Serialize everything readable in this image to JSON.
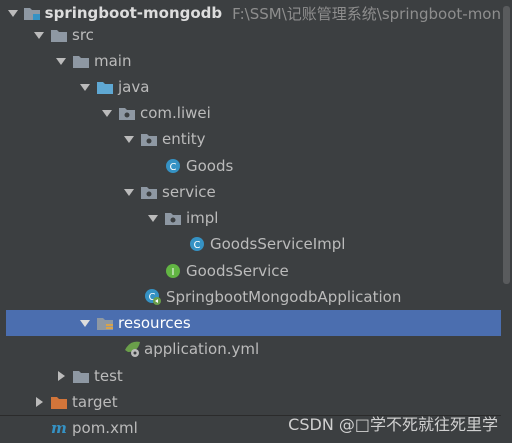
{
  "project": {
    "name": "springboot-mongodb",
    "path": "F:\\SSM\\记账管理系统\\springboot-mon"
  },
  "tree": {
    "src": "src",
    "main": "main",
    "java": "java",
    "package": "com.liwei",
    "entity": "entity",
    "goods": "Goods",
    "service": "service",
    "impl": "impl",
    "goods_service_impl": "GoodsServiceImpl",
    "goods_service": "GoodsService",
    "application_class": "SpringbootMongodbApplication",
    "resources": "resources",
    "application_yml": "application.yml",
    "test": "test",
    "target": "target",
    "pom": "pom.xml"
  },
  "watermark": "CSDN @□学不死就往死里学",
  "colors": {
    "background": "#3c3f41",
    "selection": "#4b6eaf",
    "folder": "#8e98a3",
    "source_folder": "#5fa8d3",
    "class": "#3592c4",
    "interface": "#62b543",
    "spring": "#6a9f4a",
    "excluded": "#d29d6b"
  },
  "icons": [
    "expand-arrow",
    "collapse-arrow",
    "folder-icon",
    "package-icon",
    "class-icon",
    "interface-icon",
    "spring-boot-icon",
    "maven-icon"
  ]
}
